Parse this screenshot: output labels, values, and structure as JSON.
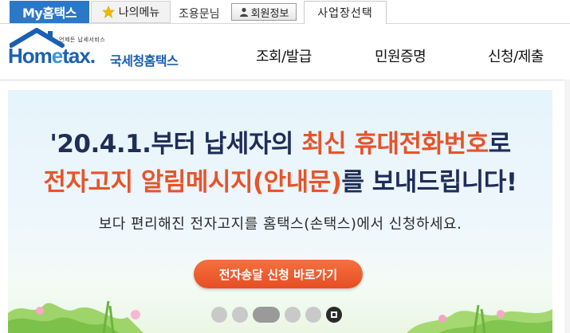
{
  "topbar": {
    "my_tab": "My홈택스",
    "fav_tab": "나의메뉴",
    "user_name": "조용문님",
    "member_btn": "회원정보",
    "biz_btn": "사업장선택"
  },
  "header": {
    "logo_sub": "언제든 납세서비스",
    "logo_main_a": "Hom",
    "logo_main_e": "e",
    "logo_main_b": "tax.",
    "logo_kr": "국세청홈택스",
    "nav": [
      "조회/발급",
      "민원증명",
      "신청/제출"
    ]
  },
  "banner": {
    "line1_a": "'20.4.1.부터 납세자의 ",
    "line1_hl": "최신 휴대전화번호",
    "line1_b": "로",
    "line2_hl": "전자고지 알림메시지(안내문)",
    "line2_b": "를 보내드립니다!",
    "line3": "보다 편리해진 전자고지를 홈택스(손택스)에서 신청하세요.",
    "cta": "전자송달 신청 바로가기"
  },
  "icons": {
    "star": "star-icon",
    "person": "person-icon",
    "stop": "stop-icon"
  },
  "colors": {
    "brand_blue": "#2b77c8",
    "accent_orange": "#e8532a",
    "headline_navy": "#1f2d57"
  },
  "slider": {
    "dot_count": 5,
    "active_index": 2
  }
}
